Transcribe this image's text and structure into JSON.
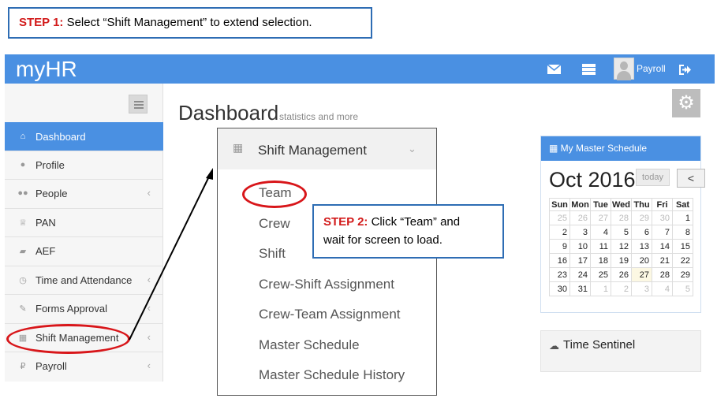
{
  "step1": {
    "label": "STEP 1:",
    "text": " Select “Shift Management” to extend selection."
  },
  "step2": {
    "label": "STEP 2:",
    "text_line1": " Click “Team” and",
    "text_line2": "wait for screen to load."
  },
  "app": {
    "title": "myHR",
    "user_name": "Payroll",
    "brand_color": "#4a90e2"
  },
  "sidebar": {
    "items": [
      {
        "label": "Dashboard",
        "icon": "home-icon",
        "glyph": "⌂",
        "active": true,
        "chevron": false
      },
      {
        "label": "Profile",
        "icon": "user-icon",
        "glyph": "●",
        "active": false,
        "chevron": false
      },
      {
        "label": "People",
        "icon": "users-icon",
        "glyph": "●●",
        "active": false,
        "chevron": true
      },
      {
        "label": "PAN",
        "icon": "trophy-icon",
        "glyph": "♕",
        "active": false,
        "chevron": false
      },
      {
        "label": "AEF",
        "icon": "folder-icon",
        "glyph": "▰",
        "active": false,
        "chevron": false
      },
      {
        "label": "Time and Attendance",
        "icon": "clock-icon",
        "glyph": "◷",
        "active": false,
        "chevron": true
      },
      {
        "label": "Forms Approval",
        "icon": "pencil-icon",
        "glyph": "✎",
        "active": false,
        "chevron": true
      },
      {
        "label": "Shift Management",
        "icon": "calendar-icon",
        "glyph": "▦",
        "active": false,
        "chevron": true
      },
      {
        "label": "Payroll",
        "icon": "ruble-icon",
        "glyph": "₽",
        "active": false,
        "chevron": true
      }
    ]
  },
  "page": {
    "title": "Dashboard",
    "subtitle": "statistics and more"
  },
  "shift_menu": {
    "header": "Shift Management",
    "items": [
      "Team",
      "Crew",
      "Shift",
      "Crew-Shift Assignment",
      "Crew-Team Assignment",
      "Master Schedule",
      "Master Schedule History"
    ]
  },
  "calendar": {
    "title": "My Master Schedule",
    "month_label": "Oct 2016",
    "today_label": "today",
    "prev_label": "<",
    "weekdays": [
      "Sun",
      "Mon",
      "Tue",
      "Wed",
      "Thu",
      "Fri",
      "Sat"
    ],
    "weeks": [
      [
        "25",
        "26",
        "27",
        "28",
        "29",
        "30",
        "1"
      ],
      [
        "2",
        "3",
        "4",
        "5",
        "6",
        "7",
        "8"
      ],
      [
        "9",
        "10",
        "11",
        "12",
        "13",
        "14",
        "15"
      ],
      [
        "16",
        "17",
        "18",
        "19",
        "20",
        "21",
        "22"
      ],
      [
        "23",
        "24",
        "25",
        "26",
        "27",
        "28",
        "29"
      ],
      [
        "30",
        "31",
        "1",
        "2",
        "3",
        "4",
        "5"
      ]
    ],
    "muted": [
      [
        0,
        0
      ],
      [
        0,
        1
      ],
      [
        0,
        2
      ],
      [
        0,
        3
      ],
      [
        0,
        4
      ],
      [
        0,
        5
      ],
      [
        5,
        2
      ],
      [
        5,
        3
      ],
      [
        5,
        4
      ],
      [
        5,
        5
      ],
      [
        5,
        6
      ]
    ],
    "today": [
      4,
      4
    ]
  },
  "time_sentinel": {
    "label": "Time Sentinel"
  },
  "annotation_color": "#d8161a"
}
